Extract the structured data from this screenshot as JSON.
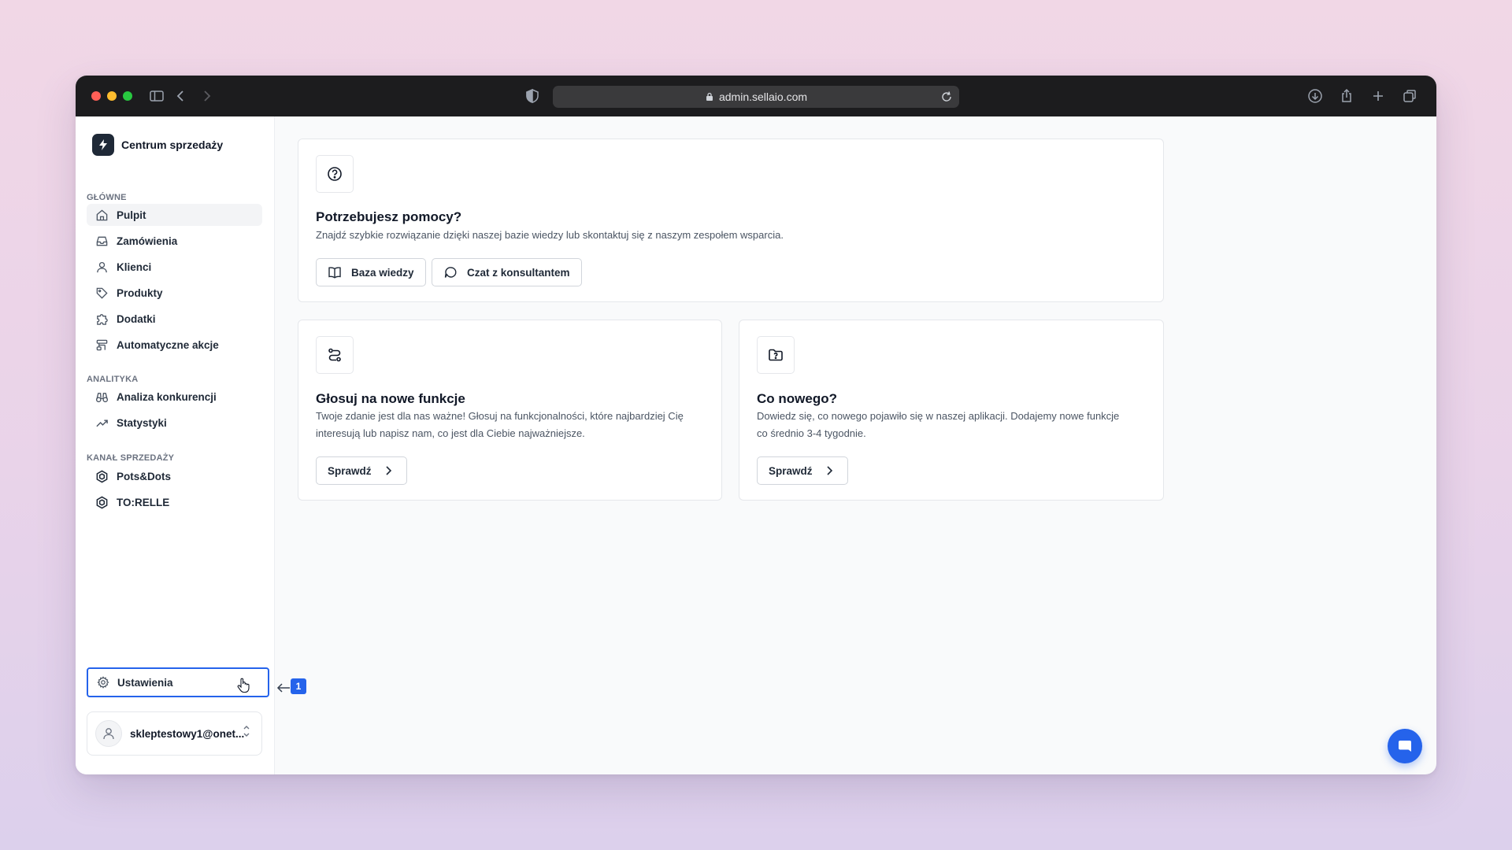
{
  "browser": {
    "url": "admin.sellaio.com",
    "traffic_lights": [
      "#ff5f57",
      "#febc2e",
      "#28c840"
    ]
  },
  "sidebar": {
    "brand": "Centrum sprzedaży",
    "sections": [
      {
        "label": "GŁÓWNE",
        "items": [
          {
            "label": "Pulpit",
            "icon": "home-icon",
            "active": true
          },
          {
            "label": "Zamówienia",
            "icon": "inbox-icon"
          },
          {
            "label": "Klienci",
            "icon": "user-icon"
          },
          {
            "label": "Produkty",
            "icon": "tag-icon"
          },
          {
            "label": "Dodatki",
            "icon": "puzzle-icon"
          },
          {
            "label": "Automatyczne akcje",
            "icon": "workflow-icon"
          }
        ]
      },
      {
        "label": "ANALITYKA",
        "items": [
          {
            "label": "Analiza konkurencji",
            "icon": "binoculars-icon"
          },
          {
            "label": "Statystyki",
            "icon": "trending-up-icon"
          }
        ]
      },
      {
        "label": "KANAŁ SPRZEDAŻY",
        "items": [
          {
            "label": "Pots&Dots",
            "icon": "hexagon-icon"
          },
          {
            "label": "TO:RELLE",
            "icon": "hexagon-icon"
          }
        ]
      }
    ],
    "settings_label": "Ustawienia",
    "callout_number": "1",
    "account_email": "skleptestowy1@onet..."
  },
  "cards": {
    "help": {
      "title": "Potrzebujesz pomocy?",
      "description": "Znajdź szybkie rozwiązanie dzięki naszej bazie wiedzy lub skontaktuj się z naszym zespołem wsparcia.",
      "buttons": [
        "Baza wiedzy",
        "Czat z konsultantem"
      ]
    },
    "vote": {
      "title": "Głosuj na nowe funkcje",
      "description_line1": "Twoje zdanie jest dla nas ważne! Głosuj na funkcjonalności, które najbardziej Cię",
      "description_line2": "interesują lub napisz nam, co jest dla Ciebie najważniejsze.",
      "button": "Sprawdź"
    },
    "news": {
      "title": "Co nowego?",
      "description_line1": "Dowiedz się, co nowego pojawiło się w naszej aplikacji. Dodajemy nowe funkcje",
      "description_line2": "co średnio 3-4 tygodnie.",
      "button": "Sprawdź"
    }
  },
  "colors": {
    "accent": "#2563eb",
    "titlebar": "#1c1c1e"
  }
}
